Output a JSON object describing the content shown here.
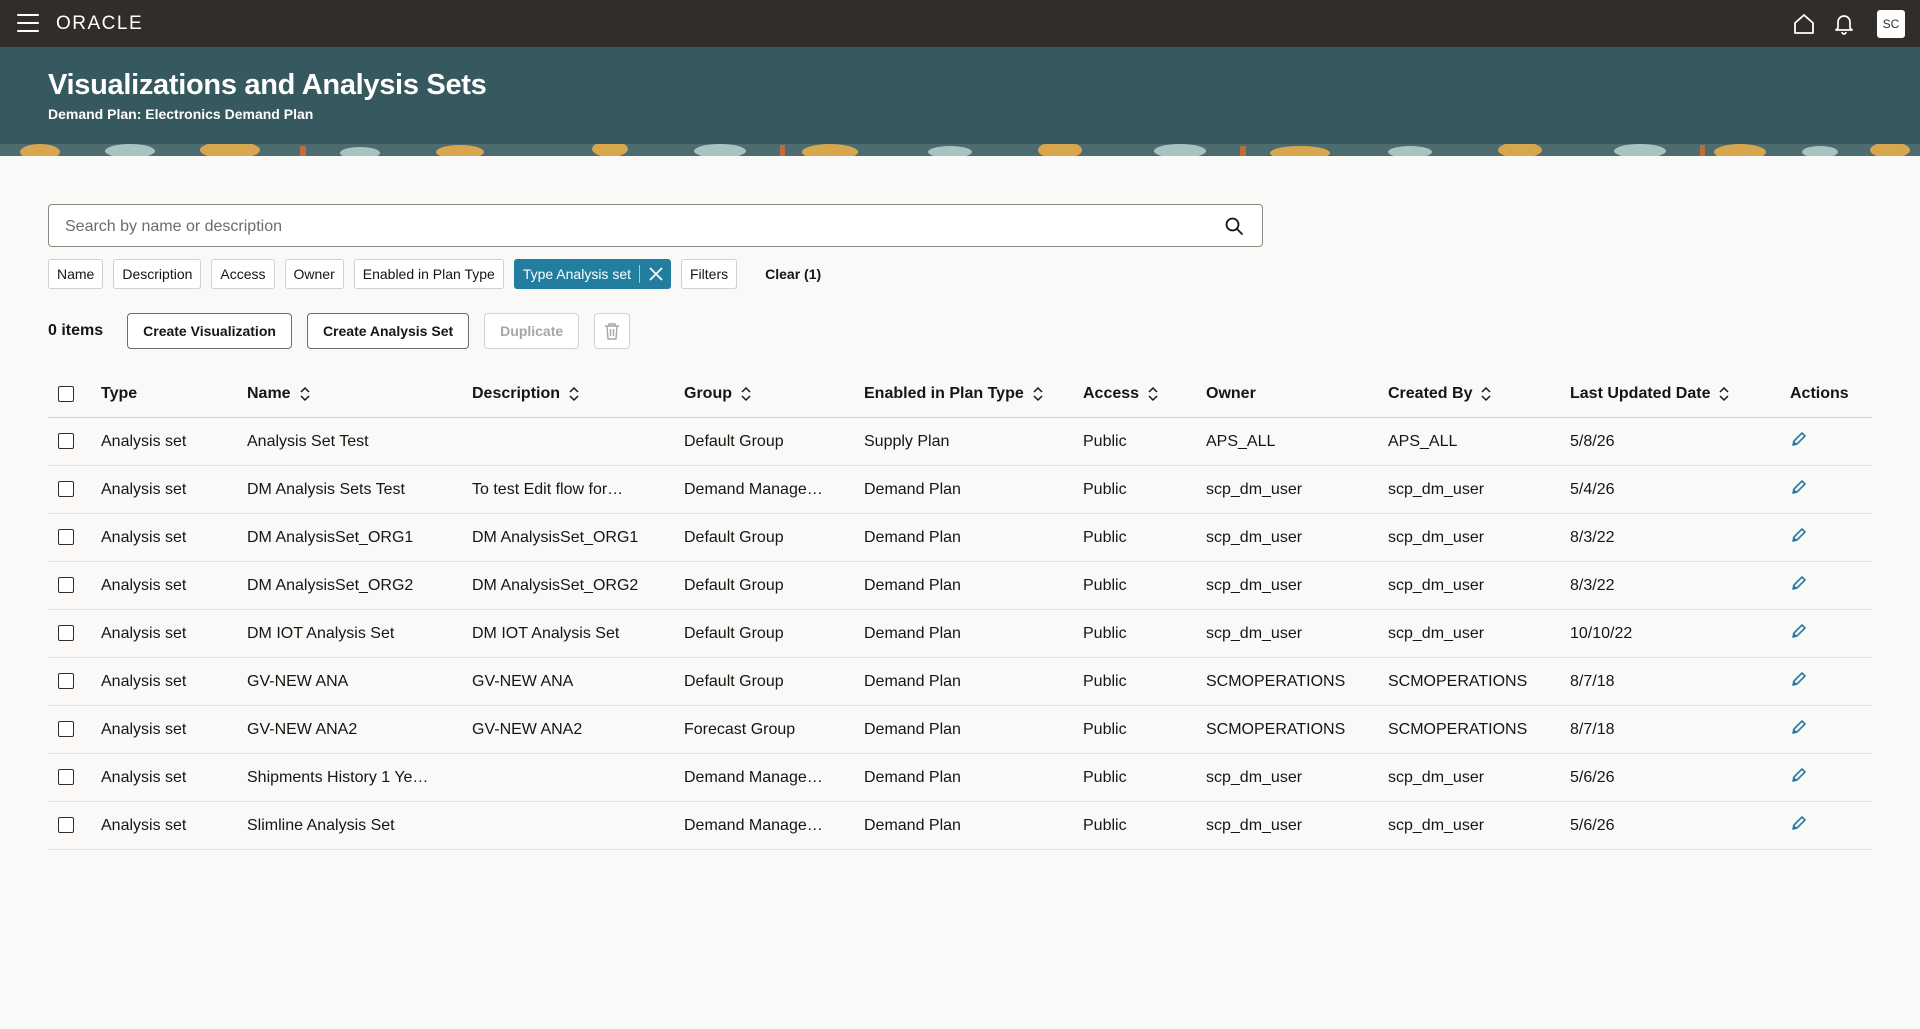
{
  "app": {
    "logo": "ORACLE",
    "avatar_initials": "SC"
  },
  "banner": {
    "title": "Visualizations and Analysis Sets",
    "subtitle": "Demand Plan: Electronics Demand Plan"
  },
  "search": {
    "placeholder": "Search by name or description"
  },
  "filters": {
    "chips": [
      "Name",
      "Description",
      "Access",
      "Owner",
      "Enabled in Plan Type"
    ],
    "active_chip": "Type Analysis set",
    "filters_label": "Filters",
    "clear_label": "Clear (1)"
  },
  "toolbar": {
    "count": "0 items",
    "create_visualization": "Create Visualization",
    "create_analysis_set": "Create Analysis Set",
    "duplicate": "Duplicate"
  },
  "table": {
    "columns": [
      "Type",
      "Name",
      "Description",
      "Group",
      "Enabled in Plan Type",
      "Access",
      "Owner",
      "Created By",
      "Last Updated Date",
      "Actions"
    ],
    "rows": [
      [
        "Analysis set",
        "Analysis Set Test",
        "",
        "Default Group",
        "Supply Plan",
        "Public",
        "APS_ALL",
        "APS_ALL",
        "5/8/26"
      ],
      [
        "Analysis set",
        "DM Analysis Sets Test",
        "To test Edit flow for…",
        "Demand Manage…",
        "Demand Plan",
        "Public",
        "scp_dm_user",
        "scp_dm_user",
        "5/4/26"
      ],
      [
        "Analysis set",
        "DM AnalysisSet_ORG1",
        "DM AnalysisSet_ORG1",
        "Default Group",
        "Demand Plan",
        "Public",
        "scp_dm_user",
        "scp_dm_user",
        "8/3/22"
      ],
      [
        "Analysis set",
        "DM AnalysisSet_ORG2",
        "DM AnalysisSet_ORG2",
        "Default Group",
        "Demand Plan",
        "Public",
        "scp_dm_user",
        "scp_dm_user",
        "8/3/22"
      ],
      [
        "Analysis set",
        "DM IOT Analysis Set",
        "DM IOT Analysis Set",
        "Default Group",
        "Demand Plan",
        "Public",
        "scp_dm_user",
        "scp_dm_user",
        "10/10/22"
      ],
      [
        "Analysis set",
        "GV-NEW ANA",
        "GV-NEW ANA",
        "Default Group",
        "Demand Plan",
        "Public",
        "SCMOPERATIONS",
        "SCMOPERATIONS",
        "8/7/18"
      ],
      [
        "Analysis set",
        "GV-NEW ANA2",
        "GV-NEW ANA2",
        "Forecast Group",
        "Demand Plan",
        "Public",
        "SCMOPERATIONS",
        "SCMOPERATIONS",
        "8/7/18"
      ],
      [
        "Analysis set",
        "Shipments History 1 Ye…",
        "",
        "Demand Manage…",
        "Demand Plan",
        "Public",
        "scp_dm_user",
        "scp_dm_user",
        "5/6/26"
      ],
      [
        "Analysis set",
        "Slimline Analysis Set",
        "",
        "Demand Manage…",
        "Demand Plan",
        "Public",
        "scp_dm_user",
        "scp_dm_user",
        "5/6/26"
      ]
    ]
  },
  "colors": {
    "topbar": "#312d2a",
    "banner": "#36585f",
    "accent": "#227e9e"
  }
}
